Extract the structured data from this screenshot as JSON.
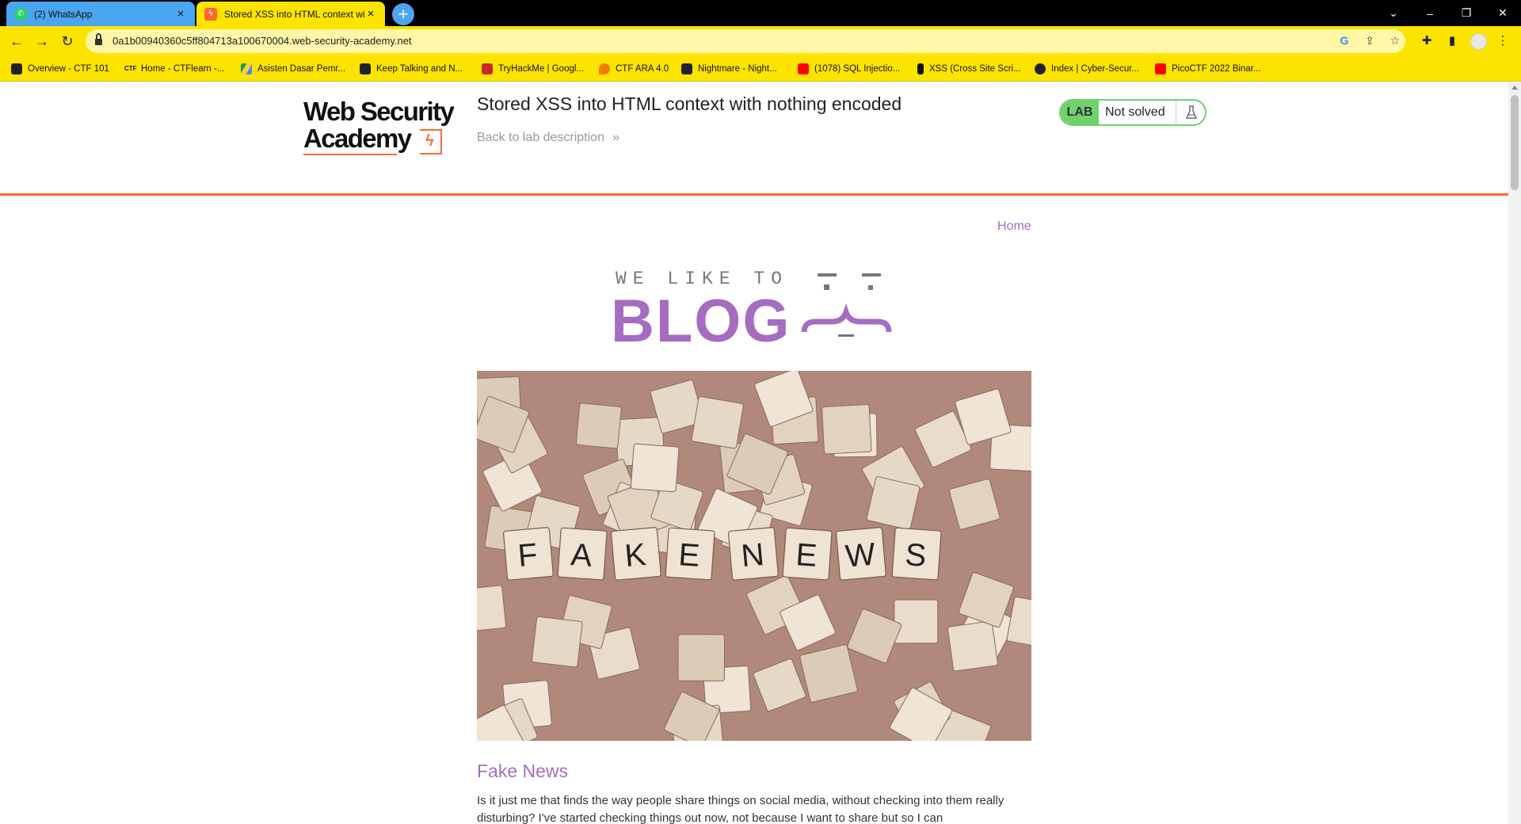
{
  "browser": {
    "tabs": [
      {
        "title": "(2) WhatsApp",
        "favicon": "whatsapp-icon",
        "active": false
      },
      {
        "title": "Stored XSS into HTML context wi",
        "favicon": "web-security-academy-icon",
        "active": true
      }
    ],
    "new_tab_label": "+",
    "url": "0a1b00940360c5ff804713a100670004.web-security-academy.net",
    "accent_color": "#fde400",
    "bookmarks": [
      {
        "label": "Overview - CTF 101",
        "icon": "book-icon"
      },
      {
        "label": "Home - CTFlearn -...",
        "icon": "ctf-icon"
      },
      {
        "label": "Asisten Dasar Pemr...",
        "icon": "google-drive-icon"
      },
      {
        "label": "Keep Talking and N...",
        "icon": "bomb-icon"
      },
      {
        "label": "TryHackMe | Googl...",
        "icon": "tryhackme-icon"
      },
      {
        "label": "CTF ARA 4.0",
        "icon": "flame-icon"
      },
      {
        "label": "Nightmare - Night...",
        "icon": "book-icon"
      },
      {
        "label": "(1078) SQL Injectio...",
        "icon": "youtube-icon"
      },
      {
        "label": "XSS (Cross Site Scri...",
        "icon": "bookmark-icon"
      },
      {
        "label": "Index | Cyber-Secur...",
        "icon": "github-icon"
      },
      {
        "label": "PicoCTF 2022 Binar...",
        "icon": "youtube-icon"
      }
    ]
  },
  "academy": {
    "logo_line1": "Web Security",
    "logo_line2": "Academy",
    "lab_title": "Stored XSS into HTML context with nothing encoded",
    "back_link": "Back to lab description",
    "back_chevron": "»",
    "status_tag": "LAB",
    "status_text": "Not solved",
    "status_color": "#70d16d",
    "brand_color": "#ff6633"
  },
  "blog": {
    "nav_home": "Home",
    "header_small": "WE LIKE TO",
    "header_big": "BLOG",
    "accent_color": "#a56cc1",
    "post": {
      "image_letters": [
        "F",
        "A",
        "K",
        "E",
        "N",
        "E",
        "W",
        "S"
      ],
      "title": "Fake News",
      "body": "Is it just me that finds the way people share things on social media, without checking into them really disturbing? I've started checking things out now, not because I want to share but so I can"
    }
  }
}
